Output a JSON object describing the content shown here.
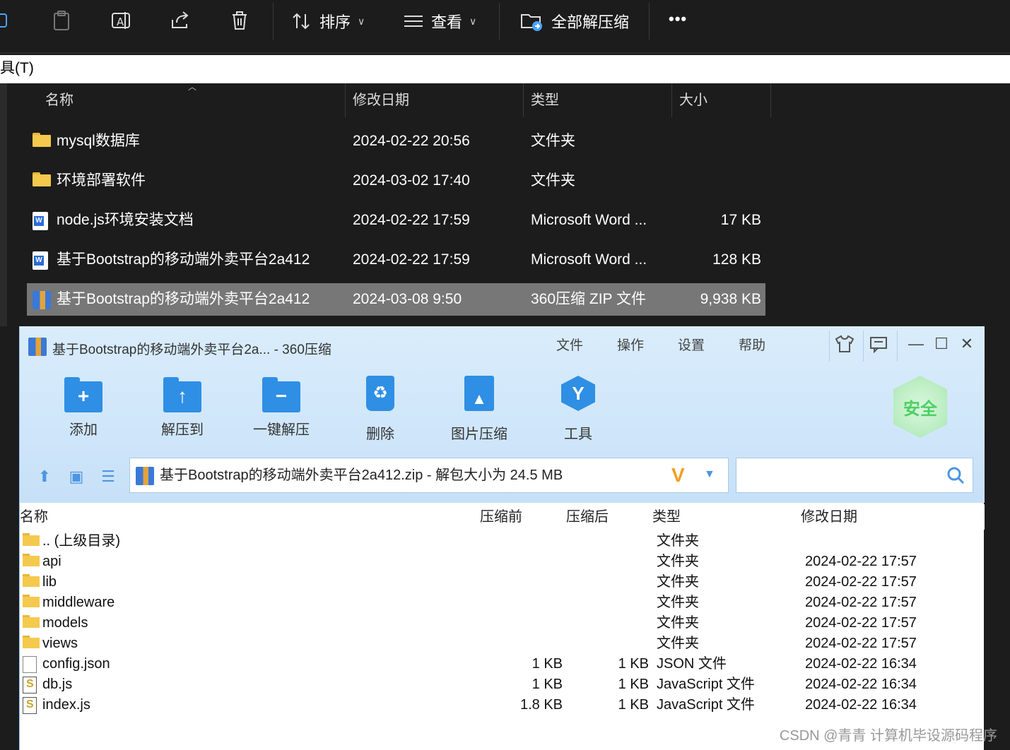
{
  "toolbar": {
    "sort_label": "排序",
    "view_label": "查看",
    "extract_all_label": "全部解压缩",
    "more_label": "•••"
  },
  "menu_strip": {
    "text": "具(T)"
  },
  "explorer": {
    "columns": {
      "name": "名称",
      "modified": "修改日期",
      "type": "类型",
      "size": "大小"
    },
    "rows": [
      {
        "icon": "folder-icon",
        "name": "mysql数据库",
        "modified": "2024-02-22 20:56",
        "type": "文件夹",
        "size": ""
      },
      {
        "icon": "folder-icon",
        "name": "环境部署软件",
        "modified": "2024-03-02 17:40",
        "type": "文件夹",
        "size": ""
      },
      {
        "icon": "word-doc-icon",
        "name": "node.js环境安装文档",
        "modified": "2024-02-22 17:59",
        "type": "Microsoft Word ...",
        "size": "17 KB"
      },
      {
        "icon": "word-doc-icon",
        "name": "基于Bootstrap的移动端外卖平台2a412",
        "modified": "2024-02-22 17:59",
        "type": "Microsoft Word ...",
        "size": "128 KB"
      },
      {
        "icon": "zip-archive-icon",
        "name": "基于Bootstrap的移动端外卖平台2a412",
        "modified": "2024-03-08 9:50",
        "type": "360压缩 ZIP 文件",
        "size": "9,938 KB",
        "selected": true
      }
    ]
  },
  "zipwin": {
    "title": "基于Bootstrap的移动端外卖平台2a... - 360压缩",
    "menu": {
      "file": "文件",
      "operate": "操作",
      "settings": "设置",
      "help": "帮助"
    },
    "buttons": {
      "add": "添加",
      "extract_to": "解压到",
      "one_click_extract": "一键解压",
      "delete": "删除",
      "image_compress": "图片压缩",
      "tools": "工具"
    },
    "safe_badge": "安全",
    "address": "基于Bootstrap的移动端外卖平台2a412.zip - 解包大小为 24.5 MB",
    "search": {
      "value": ""
    },
    "columns": {
      "name": "名称",
      "before": "压缩前",
      "after": "压缩后",
      "type": "类型",
      "modified": "修改日期"
    },
    "rows": [
      {
        "icon": "folder-icon",
        "name": ".. (上级目录)",
        "before": "",
        "after": "",
        "type": "文件夹",
        "modified": ""
      },
      {
        "icon": "folder-icon",
        "name": "api",
        "before": "",
        "after": "",
        "type": "文件夹",
        "modified": "2024-02-22 17:57"
      },
      {
        "icon": "folder-icon",
        "name": "lib",
        "before": "",
        "after": "",
        "type": "文件夹",
        "modified": "2024-02-22 17:57"
      },
      {
        "icon": "folder-icon",
        "name": "middleware",
        "before": "",
        "after": "",
        "type": "文件夹",
        "modified": "2024-02-22 17:57"
      },
      {
        "icon": "folder-icon",
        "name": "models",
        "before": "",
        "after": "",
        "type": "文件夹",
        "modified": "2024-02-22 17:57"
      },
      {
        "icon": "folder-icon",
        "name": "views",
        "before": "",
        "after": "",
        "type": "文件夹",
        "modified": "2024-02-22 17:57"
      },
      {
        "icon": "file-icon",
        "name": "config.json",
        "before": "1 KB",
        "after": "1 KB",
        "type": "JSON 文件",
        "modified": "2024-02-22 16:34"
      },
      {
        "icon": "js-file-icon",
        "name": "db.js",
        "before": "1 KB",
        "after": "1 KB",
        "type": "JavaScript 文件",
        "modified": "2024-02-22 16:34"
      },
      {
        "icon": "js-file-icon",
        "name": "index.js",
        "before": "1.8 KB",
        "after": "1 KB",
        "type": "JavaScript 文件",
        "modified": "2024-02-22 16:34"
      }
    ]
  },
  "watermark": "CSDN @青青  计算机毕设源码程序"
}
